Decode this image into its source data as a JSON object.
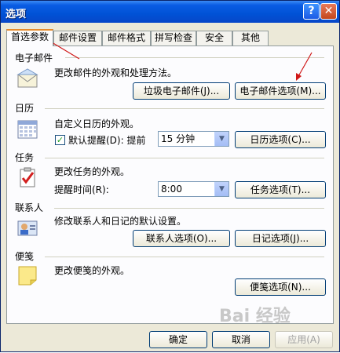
{
  "window": {
    "title": "选项",
    "help": "?",
    "close": "✕"
  },
  "tabs": [
    {
      "label": "首选参数",
      "active": true
    },
    {
      "label": "邮件设置"
    },
    {
      "label": "邮件格式"
    },
    {
      "label": "拼写检查"
    },
    {
      "label": "安全"
    },
    {
      "label": "其他"
    }
  ],
  "email": {
    "title": "电子邮件",
    "desc": "更改邮件的外观和处理方法。",
    "junk_btn": "垃圾电子邮件(J)...",
    "options_btn": "电子邮件选项(M)..."
  },
  "calendar": {
    "title": "日历",
    "desc": "自定义日历的外观。",
    "reminder_label": "默认提醒(D): 提前",
    "reminder_checked": true,
    "reminder_value": "15 分钟",
    "options_btn": "日历选项(C)..."
  },
  "tasks": {
    "title": "任务",
    "desc": "更改任务的外观。",
    "time_label": "提醒时间(R):",
    "time_value": "8:00",
    "options_btn": "任务选项(T)..."
  },
  "contacts": {
    "title": "联系人",
    "desc": "修改联系人和日记的默认设置。",
    "contact_btn": "联系人选项(O)...",
    "journal_btn": "日记选项(J)..."
  },
  "notes": {
    "title": "便笺",
    "desc": "更改便笺的外观。",
    "options_btn": "便笺选项(N)..."
  },
  "footer": {
    "ok": "确定",
    "cancel": "取消",
    "apply": "应用(A)"
  },
  "watermark": "Bai 经验"
}
